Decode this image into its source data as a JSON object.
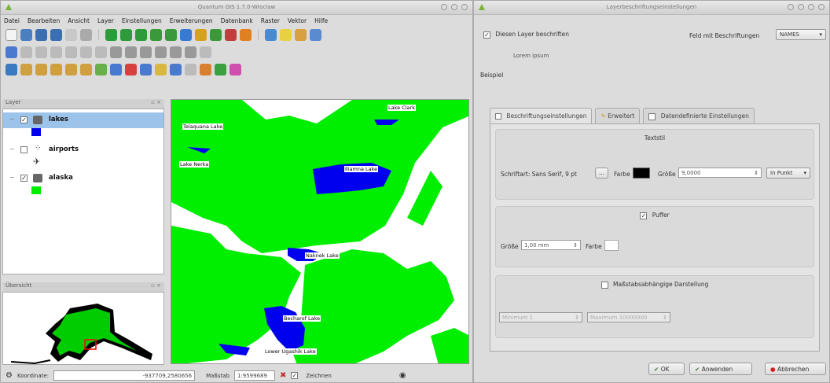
{
  "qgis": {
    "title": "Quantum GIS 1.7.0-Wroclaw",
    "menu": [
      "Datei",
      "Bearbeiten",
      "Ansicht",
      "Layer",
      "Einstellungen",
      "Erweiterungen",
      "Datenbank",
      "Raster",
      "Vektor",
      "Hilfe"
    ],
    "layers_panel_title": "Layer",
    "layers": [
      {
        "name": "lakes",
        "checked": true,
        "legend_color": "#0000ee"
      },
      {
        "name": "airports",
        "checked": false,
        "legend_color": "#000000"
      },
      {
        "name": "alaska",
        "checked": true,
        "legend_color": "#00ee00"
      }
    ],
    "overview_title": "Übersicht",
    "map_labels": [
      "Lake Clark",
      "Telaquana Lake",
      "Lake Nerka",
      "Iliamna Lake",
      "Naknek Lake",
      "Becharof Lake",
      "Lower Ugashik Lake"
    ],
    "status": {
      "coord_label": "Koordinate:",
      "coord_value": "-937709,2580656",
      "scale_label": "Maßstab",
      "scale_value": "1:9599689",
      "render_label": "Zeichnen"
    }
  },
  "dialog": {
    "title": "Layerbeschriftungseinstellungen",
    "label_layer_checkbox": "Diesen Layer beschriften",
    "label_layer_checked": true,
    "field_label": "Feld mit Beschriftungen",
    "field_value": "NAMES",
    "sample_text": "Lorem ipsum",
    "example_label": "Beispiel",
    "tabs": [
      "Beschriftungseinstellungen",
      "Erweitert",
      "Datendefinierte Einstellungen"
    ],
    "text_group": "Textstil",
    "font_label": "Schriftart: Sans Serif, 9 pt",
    "font_btn": "...",
    "color_label": "Farbe",
    "size_label": "Größe",
    "size_value": "9,0000",
    "unit_value": "In Punkt",
    "buffer_group": "Puffer",
    "buffer_checked": true,
    "buffer_size_label": "Größe",
    "buffer_size_value": "1,00 mm",
    "buffer_color_label": "Farbe",
    "scale_group": "Maßstabsabhängige Darstellung",
    "scale_checked": false,
    "min_scale": "Minimum 1",
    "max_scale": "Maximum 10000000",
    "btn_ok": "OK",
    "btn_apply": "Anwenden",
    "btn_cancel": "Abbrechen",
    "colors": {
      "land": "#00ee00",
      "lake": "#0000ee",
      "font_color": "#000000",
      "buffer_color": "#ffffff"
    }
  }
}
